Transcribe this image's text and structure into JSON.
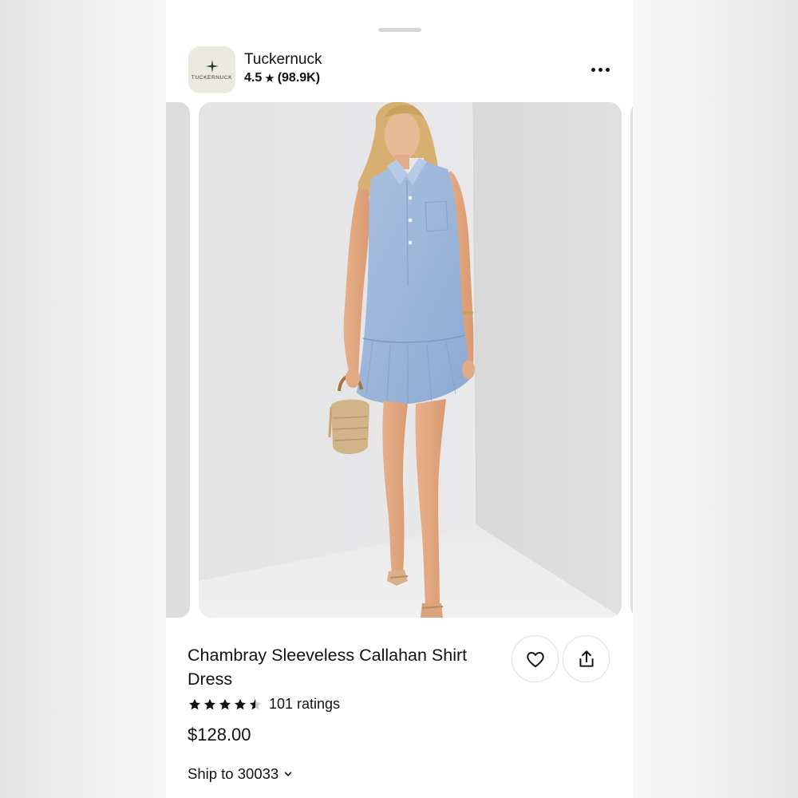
{
  "shop": {
    "logo_text": "TUCKERNUCK",
    "name": "Tuckernuck",
    "rating": "4.5",
    "review_count": "(98.9K)"
  },
  "product": {
    "title": "Chambray Sleeveless Callahan Shirt Dress",
    "stars": 4.5,
    "ratings_label": "101 ratings",
    "price": "$128.00"
  },
  "shipping": {
    "label": "Ship to 30033"
  },
  "icons": {
    "more": "more-horizontal-icon",
    "favorite": "heart-icon",
    "share": "share-icon",
    "rating_star": "star-icon",
    "chevron": "chevron-down-icon"
  },
  "colors": {
    "text": "#111111",
    "background": "#ffffff",
    "image_bg": "#e8e8e8",
    "dress": "#9fb6d8"
  }
}
